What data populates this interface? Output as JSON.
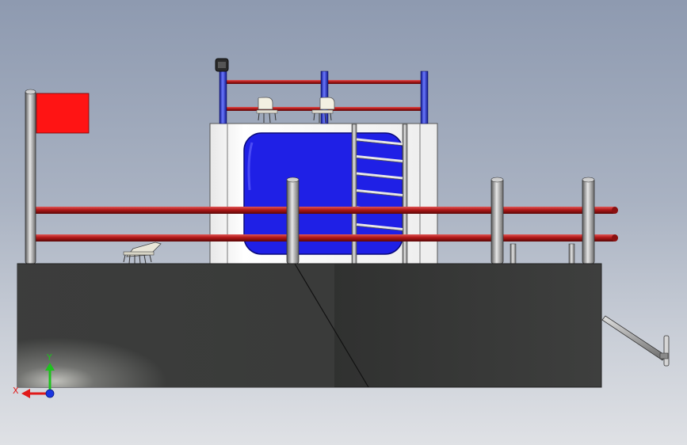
{
  "model": {
    "name": "boat-side-view",
    "colors": {
      "hull": "#3c3d3c",
      "railing_red": "#b01818",
      "railing_blue": "#2130c8",
      "cabin_white": "#f4f4f4",
      "window_blue": "#1f20e6",
      "flag_red": "#ff1414",
      "pole_gray": "#9a9a9a"
    }
  },
  "triad": {
    "x_label": "X",
    "y_label": "Y",
    "x_color": "#e01a1a",
    "y_color": "#1ec21e",
    "z_color": "#1a35e0"
  }
}
